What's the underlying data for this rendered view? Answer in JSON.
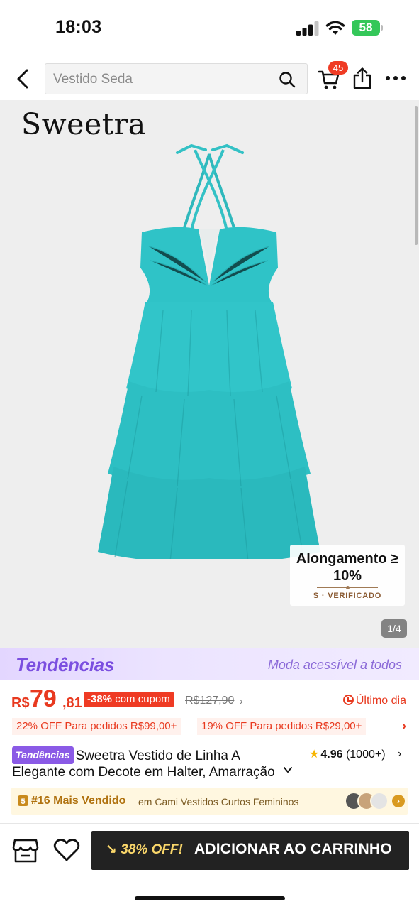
{
  "status_bar": {
    "time": "18:03",
    "battery_level": "58",
    "icons": [
      "signal-icon",
      "wifi-icon",
      "battery-icon"
    ]
  },
  "nav": {
    "back_icon": "chevron-left-icon",
    "search_text": "Vestido Seda",
    "search_icon": "search-icon",
    "cart_icon": "cart-icon",
    "cart_badge": "45",
    "share_icon": "share-icon",
    "more_icon": "more-horizontal-icon"
  },
  "product_image": {
    "brand": "Sweetra",
    "dress_color": "#2fc3c7",
    "stretch_title": "Alongamento ≥ 10%",
    "stretch_verified": "S · VERIFICADO",
    "counter": "1/4"
  },
  "trends_banner": {
    "logo": "Tendências",
    "slogan": "Moda acessível a todos"
  },
  "price": {
    "currency": "R$",
    "main": "79",
    "cents": ",81",
    "discount_pct": "-38%",
    "coupon_label": "com cupom",
    "original": "R$127,90",
    "deadline": "Último dia",
    "accent_color": "#e8391f"
  },
  "discounts": [
    "22% OFF Para pedidos R$99,00+",
    "19% OFF Para pedidos R$29,00+"
  ],
  "title": {
    "tag": "Tendências",
    "text": "Sweetra Vestido de Linha A Elegante com Decote em Halter, Amarração"
  },
  "rating": {
    "value": "4.96",
    "count": "(1000+)"
  },
  "bestseller": {
    "rank": "#16 Mais Vendido",
    "category": "em Cami Vestidos Curtos Femininos"
  },
  "bottom_bar": {
    "store_icon": "store-icon",
    "wishlist_icon": "heart-icon",
    "discount": "38% OFF!",
    "button_label": "ADICIONAR AO CARRINHO"
  }
}
